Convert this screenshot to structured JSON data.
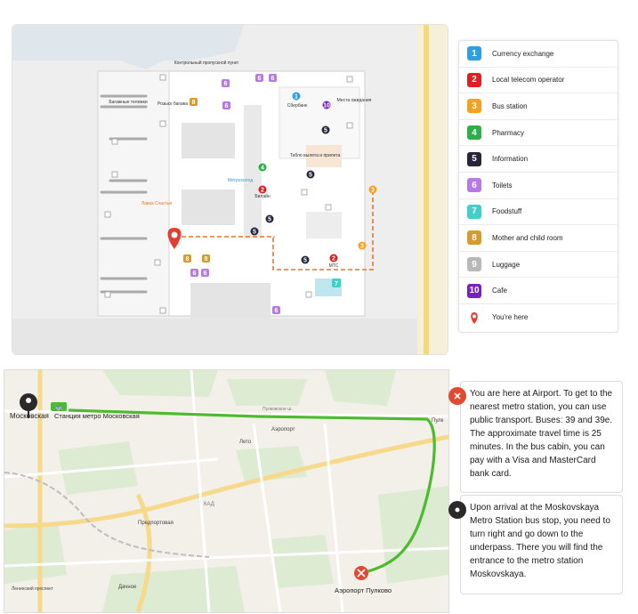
{
  "floorplan": {
    "labels": {
      "baggage_carts": "Багажные тележки",
      "baggage_claim": "Розыск багажа",
      "control_point": "Контрольный пропускной пункт",
      "waiting_area": "Места ожидания",
      "sberbank": "Сбербанк",
      "departures_board": "Табло вылета и прилета",
      "happiness_shop": "Лавка Счастья",
      "metro_shop": "Метрохолод",
      "mts": "МТС",
      "beeline": "Билайн"
    }
  },
  "legend": {
    "items": [
      {
        "num": "1",
        "label": "Currency exchange",
        "color": "#2f9fe0"
      },
      {
        "num": "2",
        "label": "Local telecom operator",
        "color": "#e02020"
      },
      {
        "num": "3",
        "label": "Bus station",
        "color": "#f4a020"
      },
      {
        "num": "4",
        "label": "Pharmacy",
        "color": "#2cae48"
      },
      {
        "num": "5",
        "label": "Information",
        "color": "#26263a"
      },
      {
        "num": "6",
        "label": "Toilets",
        "color": "#b77ae0"
      },
      {
        "num": "7",
        "label": "Foodstuff",
        "color": "#3fd0c8"
      },
      {
        "num": "8",
        "label": "Mother and child room",
        "color": "#d89a2a"
      },
      {
        "num": "9",
        "label": "Luggage",
        "color": "#b8b8b8"
      },
      {
        "num": "10",
        "label": "Cafe",
        "color": "#7a1fc0"
      },
      {
        "num": "",
        "label": "You're here",
        "color": "#e04030"
      }
    ]
  },
  "map": {
    "labels": {
      "moskovskaya": "Московская",
      "metro_station": "Станция метро Московская",
      "airport_pulkovo": "Аэропорт Пулково",
      "predportovaya": "Предпортовая",
      "lento": "Лето",
      "aeroport": "Аэропорт",
      "dachnoe": "Дачное",
      "leninsky": "Ленинский проспект",
      "kad": "КАД",
      "pulkovskoe": "Пулковское ш.",
      "pulk": "Пулк"
    }
  },
  "cards": {
    "airport_text": "You are here at Airport. To get to the nearest metro station, you can use public transport. Buses: 39 and 39e. The approximate travel time is 25 minutes. In the bus cabin, you can pay with a Visa and MasterCard bank card.",
    "metro_text": "Upon arrival at the Moskovskaya Metro Station bus stop, you need to turn right and go down to the underpass. There you will find the entrance to the metro station Moskovskaya."
  }
}
